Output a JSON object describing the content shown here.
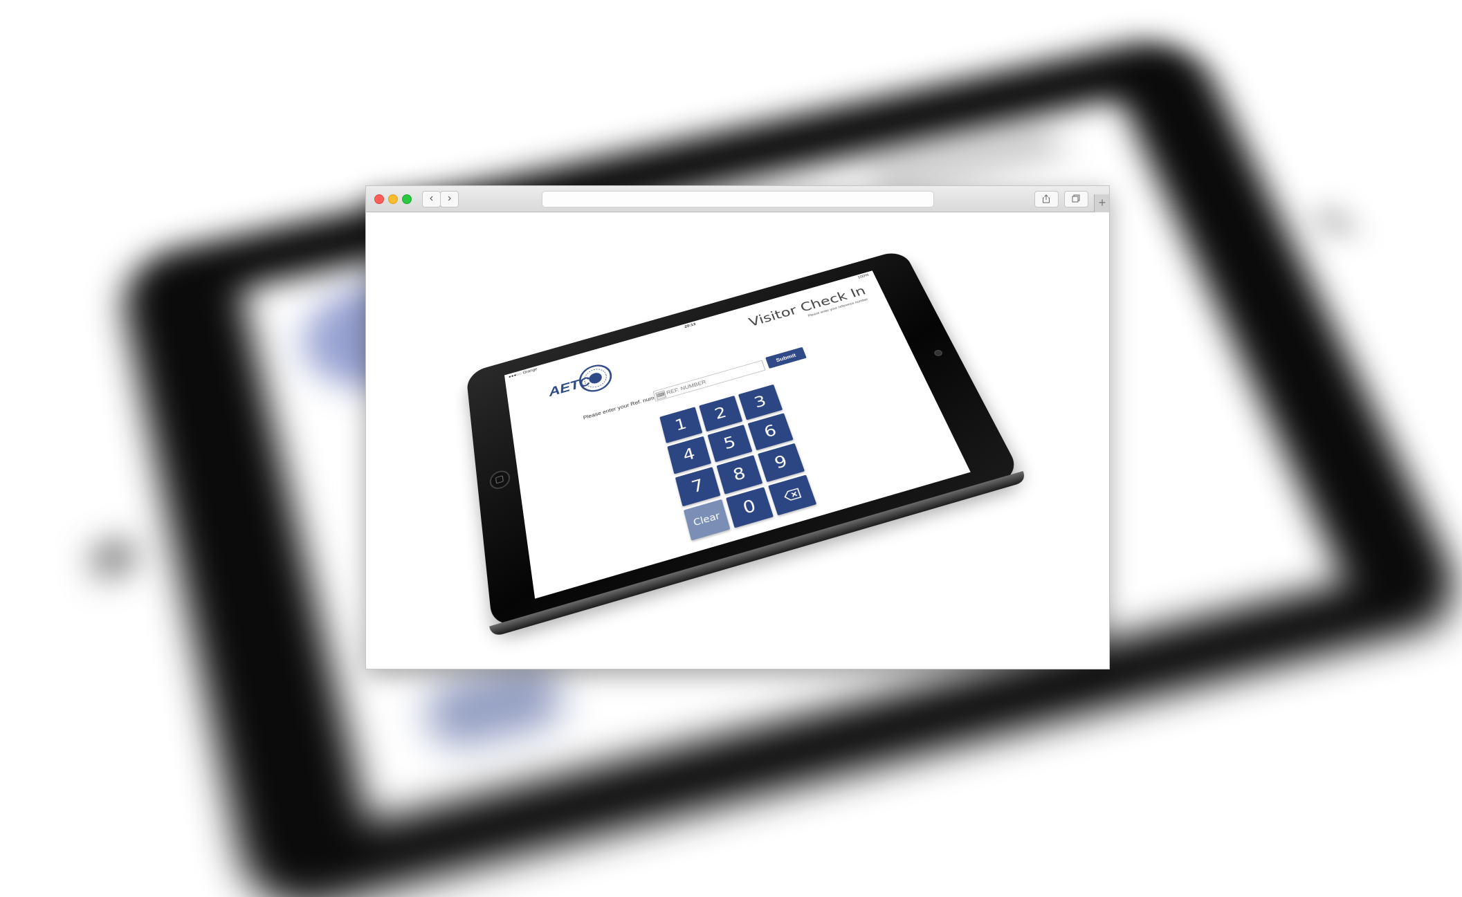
{
  "browser": {
    "nav_back_glyph": "‹",
    "nav_forward_glyph": "›",
    "new_tab_glyph": "+"
  },
  "app": {
    "status": {
      "carrier": "●●●○○ Orange",
      "time": "20:13",
      "battery": "100%"
    },
    "logo_text": "AETC",
    "title": "Visitor Check In",
    "subtitle": "Please enter your reference number",
    "ref_label": "Please enter your Ref. number:",
    "ref_input": {
      "placeholder": "REF. NUMBER",
      "value": ""
    },
    "submit_label": "Submit",
    "keypad": {
      "keys": [
        "1",
        "2",
        "3",
        "4",
        "5",
        "6",
        "7",
        "8",
        "9"
      ],
      "clear_label": "Clear",
      "zero_label": "0",
      "backspace_icon": "backspace-icon"
    },
    "colors": {
      "key": "#2c4684",
      "clear_key": "#7b8fb6",
      "submit": "#2f4a86"
    }
  }
}
